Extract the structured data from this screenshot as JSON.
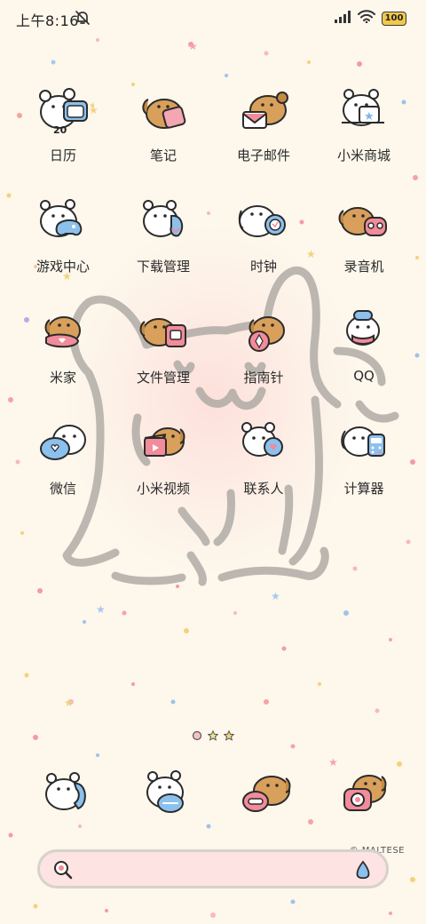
{
  "status_bar": {
    "time": "上午8:16",
    "battery": "100"
  },
  "apps": [
    {
      "label": "日历",
      "icon": "calendar-icon",
      "date": "20"
    },
    {
      "label": "笔记",
      "icon": "notes-icon"
    },
    {
      "label": "电子邮件",
      "icon": "email-icon"
    },
    {
      "label": "小米商城",
      "icon": "mi-store-icon"
    },
    {
      "label": "游戏中心",
      "icon": "game-center-icon"
    },
    {
      "label": "下载管理",
      "icon": "download-manager-icon"
    },
    {
      "label": "时钟",
      "icon": "clock-icon"
    },
    {
      "label": "录音机",
      "icon": "recorder-icon"
    },
    {
      "label": "米家",
      "icon": "mi-home-icon"
    },
    {
      "label": "文件管理",
      "icon": "file-manager-icon"
    },
    {
      "label": "指南针",
      "icon": "compass-icon"
    },
    {
      "label": "QQ",
      "icon": "qq-icon"
    },
    {
      "label": "微信",
      "icon": "wechat-icon"
    },
    {
      "label": "小米视频",
      "icon": "mi-video-icon"
    },
    {
      "label": "联系人",
      "icon": "contacts-icon"
    },
    {
      "label": "计算器",
      "icon": "calculator-icon"
    }
  ],
  "dock": [
    {
      "icon": "phone-icon"
    },
    {
      "icon": "messages-icon"
    },
    {
      "icon": "browser-icon"
    },
    {
      "icon": "camera-icon"
    }
  ],
  "page_indicator": {
    "pages": 3,
    "active": 1
  },
  "search": {
    "brand": "© MALTESE"
  },
  "colors": {
    "background": "#fdf7ec",
    "blush": "#fdcdcd",
    "puppy_brown": "#d9a05b",
    "accent_pink": "#f28b9a",
    "accent_blue": "#7db5e8",
    "battery": "#f2c84b"
  }
}
